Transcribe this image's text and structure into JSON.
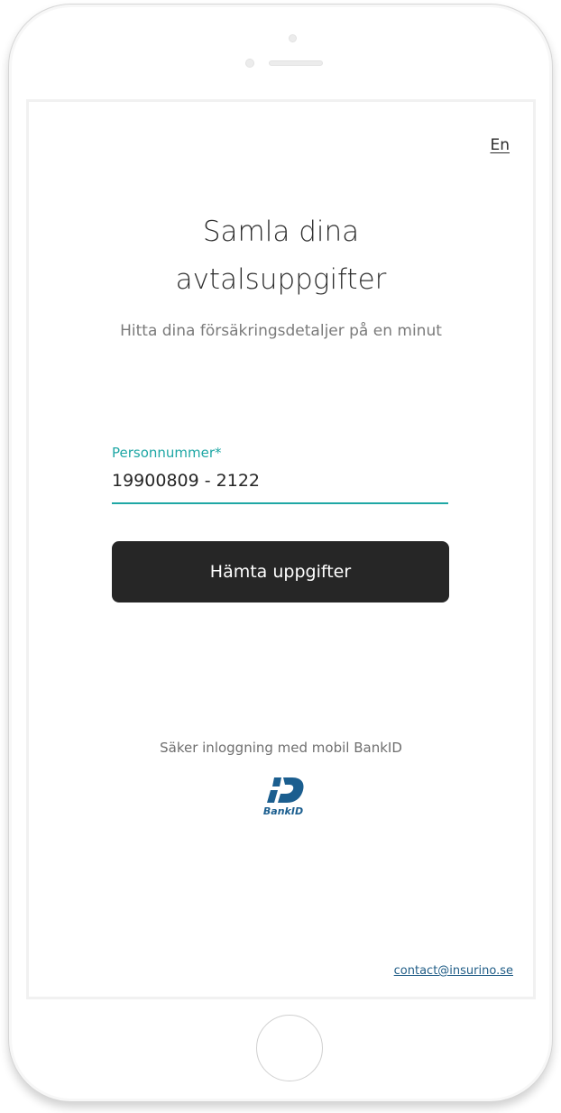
{
  "header": {
    "language_toggle": "En"
  },
  "hero": {
    "title_line1": "Samla dina",
    "title_line2": "avtalsuppgifter",
    "subtitle": "Hitta dina försäkringsdetaljer på en minut"
  },
  "form": {
    "personnummer_label": "Personnummer*",
    "personnummer_value": "19900809 - 2122",
    "submit_label": "Hämta uppgifter"
  },
  "footer": {
    "secure_login_text": "Säker inloggning med mobil BankID",
    "bankid_logo_text": "BankID",
    "contact_email": "contact@insurino.se"
  },
  "colors": {
    "accent": "#1fa7a5",
    "button_bg": "#262626",
    "bankid_blue": "#1b5e8f",
    "link": "#1f5c86"
  },
  "icons": {
    "bankid": "bankid-logo-icon"
  }
}
